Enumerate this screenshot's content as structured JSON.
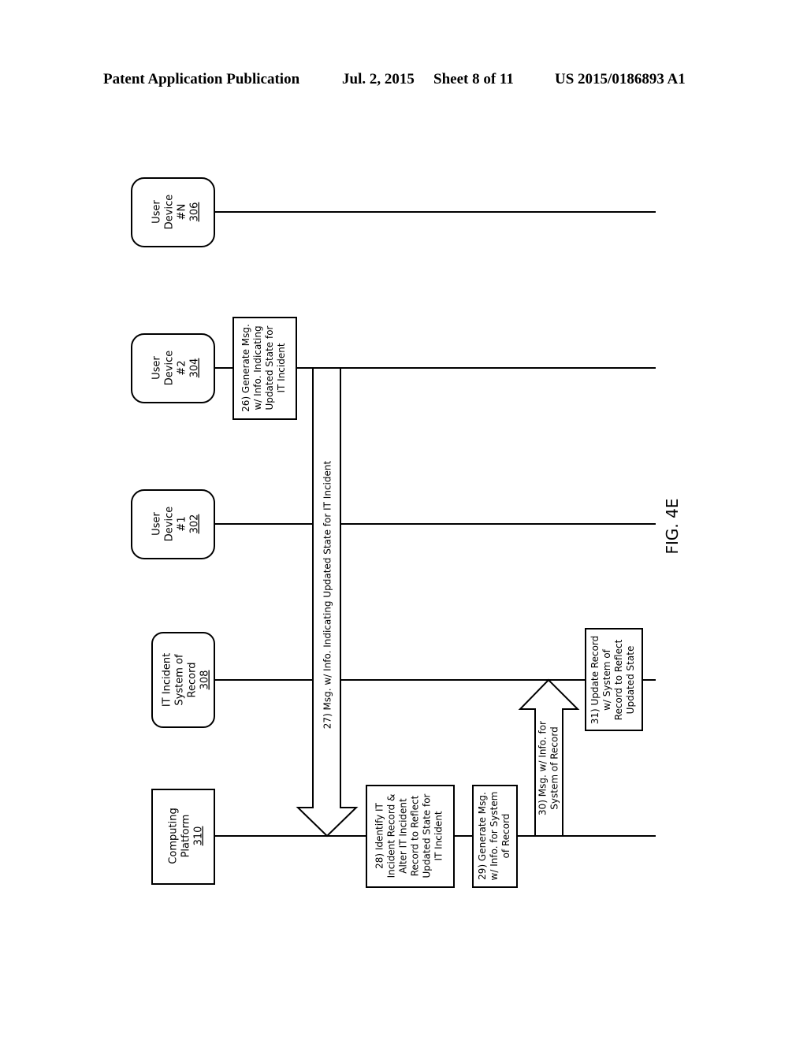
{
  "header": {
    "publication": "Patent Application Publication",
    "date": "Jul. 2, 2015",
    "sheet": "Sheet 8 of 11",
    "number": "US 2015/0186893 A1"
  },
  "figure_label": "FIG. 4E",
  "entities": [
    {
      "id": "user-device-n",
      "lines": [
        "User",
        "Device",
        "#N"
      ],
      "ref": "306"
    },
    {
      "id": "user-device-2",
      "lines": [
        "User",
        "Device",
        "#2"
      ],
      "ref": "304"
    },
    {
      "id": "user-device-1",
      "lines": [
        "User",
        "Device",
        "#1"
      ],
      "ref": "302"
    },
    {
      "id": "it-incident-system",
      "lines": [
        "IT Incident",
        "System of",
        "Record"
      ],
      "ref": "308"
    },
    {
      "id": "computing-platform",
      "lines": [
        "Computing",
        "Platform"
      ],
      "ref": "310"
    }
  ],
  "steps": {
    "s26": [
      "26) Generate Msg.",
      "w/ Info. Indicating",
      "Updated State for",
      "IT Incident"
    ],
    "s27": [
      "27) Msg. w/ Info. Indicating Updated State for IT Incident"
    ],
    "s28": [
      "28) Identify IT",
      "Incident Record &",
      "Alter IT Incident",
      "Record to Reflect",
      "Updated State for",
      "IT Incident"
    ],
    "s29": [
      "29) Generate Msg.",
      "w/ Info. for System",
      "of Record"
    ],
    "s30": [
      "30) Msg. w/ Info. for",
      "System of Record"
    ],
    "s31": [
      "31) Update Record",
      "w/ System of",
      "Record to Reflect",
      "Updated State"
    ]
  }
}
